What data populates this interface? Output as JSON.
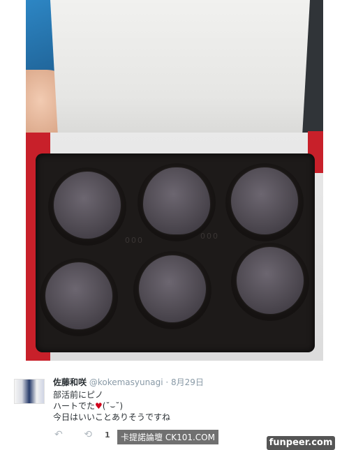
{
  "photo": {
    "tray_marks_left": "000",
    "tray_marks_right": "000"
  },
  "tweet": {
    "author_name": "佐藤和咲",
    "handle": "@kokemasyunagi",
    "separator": "·",
    "date": "8月29日",
    "lines": [
      "部活前にピノ",
      "ハートでた",
      "(˘⌣˘)",
      "今日はいいことありそうですね"
    ],
    "retweet_count": "1",
    "icons": [
      "reply-icon",
      "retweet-icon",
      "heart-icon"
    ],
    "heart_color": "#d0021b"
  },
  "watermarks": {
    "ck101": "卡提諾論壇 CK101.COM",
    "funpeer": "funpeer.com"
  }
}
